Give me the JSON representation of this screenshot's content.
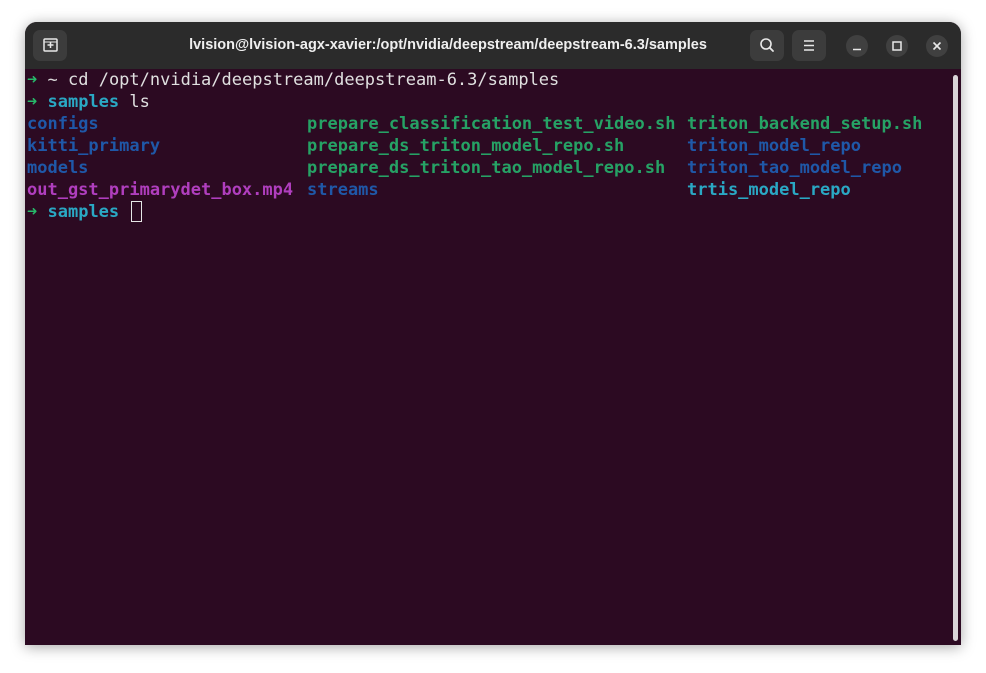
{
  "window": {
    "title": "lvision@lvision-agx-xavier:/opt/nvidia/deepstream/deepstream-6.3/samples",
    "new_tab_icon": "new-tab-icon",
    "search_icon": "search-icon",
    "menu_icon": "hamburger-menu-icon",
    "minimize_icon": "minimize-icon",
    "maximize_icon": "maximize-icon",
    "close_icon": "close-icon"
  },
  "terminal": {
    "prompt_symbol": "➜",
    "lines": [
      {
        "dir": "~",
        "command": "cd /opt/nvidia/deepstream/deepstream-6.3/samples"
      },
      {
        "dir": "samples",
        "command": "ls"
      },
      {
        "dir": "samples",
        "command": ""
      }
    ],
    "ls_output": [
      {
        "name": "configs",
        "kind": "dir"
      },
      {
        "name": "kitti_primary",
        "kind": "dir"
      },
      {
        "name": "models",
        "kind": "dir"
      },
      {
        "name": "out_gst_primarydet_box.mp4",
        "kind": "media"
      },
      {
        "name": "prepare_classification_test_video.sh",
        "kind": "exe"
      },
      {
        "name": "prepare_ds_triton_model_repo.sh",
        "kind": "exe"
      },
      {
        "name": "prepare_ds_triton_tao_model_repo.sh",
        "kind": "exe"
      },
      {
        "name": "streams",
        "kind": "dir"
      },
      {
        "name": "triton_backend_setup.sh",
        "kind": "exe"
      },
      {
        "name": "triton_model_repo",
        "kind": "dir"
      },
      {
        "name": "triton_tao_model_repo",
        "kind": "dir"
      },
      {
        "name": "trtis_model_repo",
        "kind": "other"
      }
    ]
  },
  "colors": {
    "background": "#2c0a22",
    "titlebar": "#2b2b2b",
    "prompt_arrow": "#27b86a",
    "prompt_dir": "#2aa8c4",
    "directory": "#1f58a8",
    "executable": "#26a265",
    "media": "#b03ebe"
  }
}
